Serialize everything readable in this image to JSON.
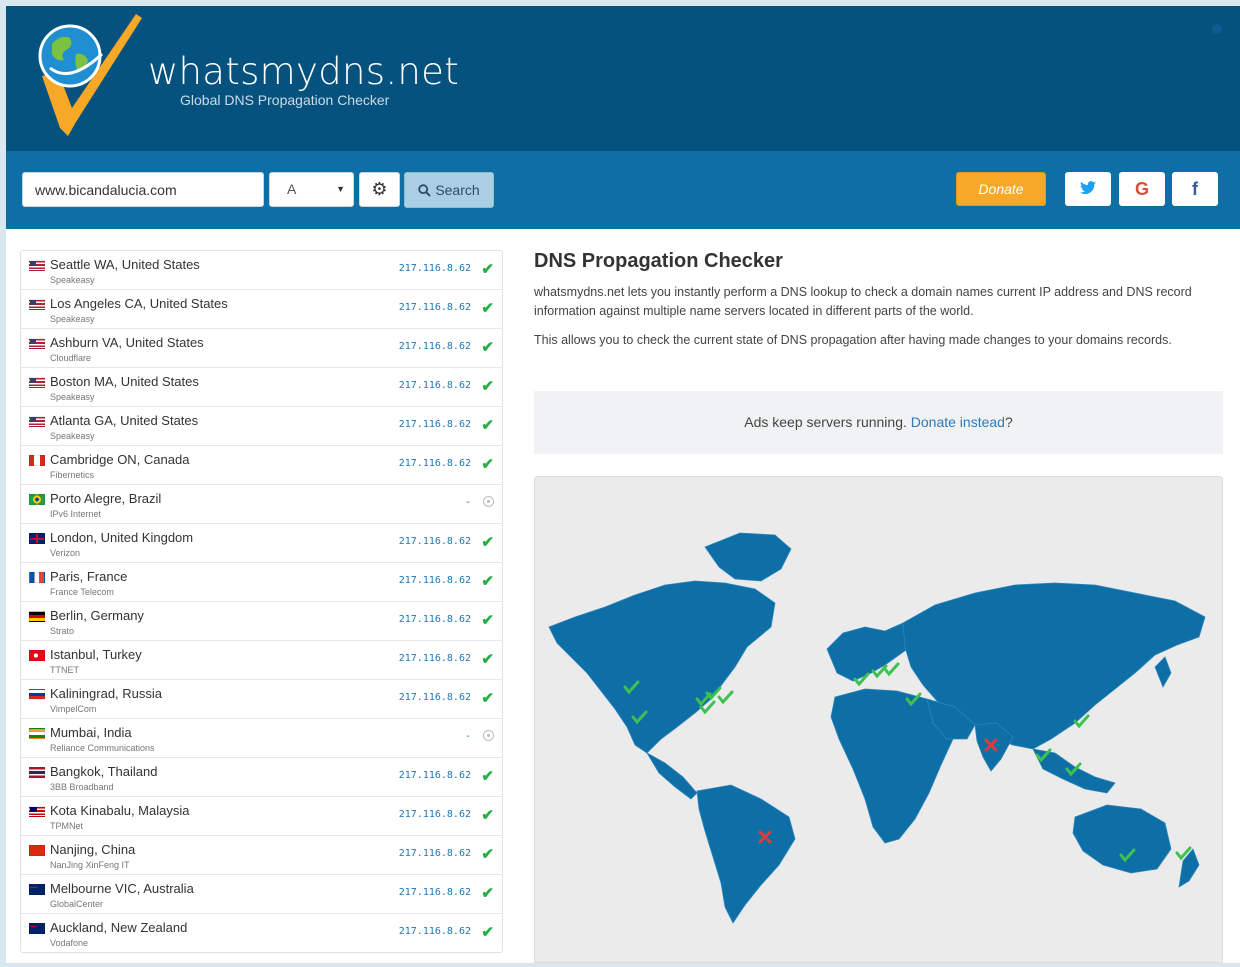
{
  "brand": {
    "name": "whatsmydns.net",
    "tagline": "Global DNS Propagation Checker"
  },
  "search": {
    "domain": "www.bicandalucia.com",
    "record_type": "A",
    "search_label": "Search",
    "donate_label": "Donate"
  },
  "social": {
    "twitter": "twitter-icon",
    "google": "G",
    "facebook": "f"
  },
  "info": {
    "title": "DNS Propagation Checker",
    "p1": "whatsmydns.net lets you instantly perform a DNS lookup to check a domain names current IP address and DNS record information against multiple name servers located in different parts of the world.",
    "p2": "This allows you to check the current state of DNS propagation after having made changes to your domains records."
  },
  "ad": {
    "text": "Ads keep servers running.",
    "link": "Donate instead",
    "suffix": "?"
  },
  "colors": {
    "header": "#06527e",
    "toolbar": "#0d6fa6",
    "ok": "#27ae45",
    "fail": "#e03b3b",
    "map_land": "#0d6fa6"
  },
  "servers": [
    {
      "location": "Seattle WA, United States",
      "provider": "Speakeasy",
      "result": "217.116.8.62",
      "status": "ok",
      "flag": "us"
    },
    {
      "location": "Los Angeles CA, United States",
      "provider": "Speakeasy",
      "result": "217.116.8.62",
      "status": "ok",
      "flag": "us"
    },
    {
      "location": "Ashburn VA, United States",
      "provider": "Cloudflare",
      "result": "217.116.8.62",
      "status": "ok",
      "flag": "us"
    },
    {
      "location": "Boston MA, United States",
      "provider": "Speakeasy",
      "result": "217.116.8.62",
      "status": "ok",
      "flag": "us"
    },
    {
      "location": "Atlanta GA, United States",
      "provider": "Speakeasy",
      "result": "217.116.8.62",
      "status": "ok",
      "flag": "us"
    },
    {
      "location": "Cambridge ON, Canada",
      "provider": "Fibernetics",
      "result": "217.116.8.62",
      "status": "ok",
      "flag": "ca"
    },
    {
      "location": "Porto Alegre, Brazil",
      "provider": "IPv6 Internet",
      "result": "-",
      "status": "none",
      "flag": "br"
    },
    {
      "location": "London, United Kingdom",
      "provider": "Verizon",
      "result": "217.116.8.62",
      "status": "ok",
      "flag": "gb"
    },
    {
      "location": "Paris, France",
      "provider": "France Telecom",
      "result": "217.116.8.62",
      "status": "ok",
      "flag": "fr"
    },
    {
      "location": "Berlin, Germany",
      "provider": "Strato",
      "result": "217.116.8.62",
      "status": "ok",
      "flag": "de"
    },
    {
      "location": "Istanbul, Turkey",
      "provider": "TTNET",
      "result": "217.116.8.62",
      "status": "ok",
      "flag": "tr"
    },
    {
      "location": "Kaliningrad, Russia",
      "provider": "VimpelCom",
      "result": "217.116.8.62",
      "status": "ok",
      "flag": "ru"
    },
    {
      "location": "Mumbai, India",
      "provider": "Reliance Communications",
      "result": "-",
      "status": "none",
      "flag": "in"
    },
    {
      "location": "Bangkok, Thailand",
      "provider": "3BB Broadband",
      "result": "217.116.8.62",
      "status": "ok",
      "flag": "th"
    },
    {
      "location": "Kota Kinabalu, Malaysia",
      "provider": "TPMNet",
      "result": "217.116.8.62",
      "status": "ok",
      "flag": "my"
    },
    {
      "location": "Nanjing, China",
      "provider": "NanJing XinFeng IT",
      "result": "217.116.8.62",
      "status": "ok",
      "flag": "cn"
    },
    {
      "location": "Melbourne VIC, Australia",
      "provider": "GlobalCenter",
      "result": "217.116.8.62",
      "status": "ok",
      "flag": "au"
    },
    {
      "location": "Auckland, New Zealand",
      "provider": "Vodafone",
      "result": "217.116.8.62",
      "status": "ok",
      "flag": "nz"
    }
  ]
}
